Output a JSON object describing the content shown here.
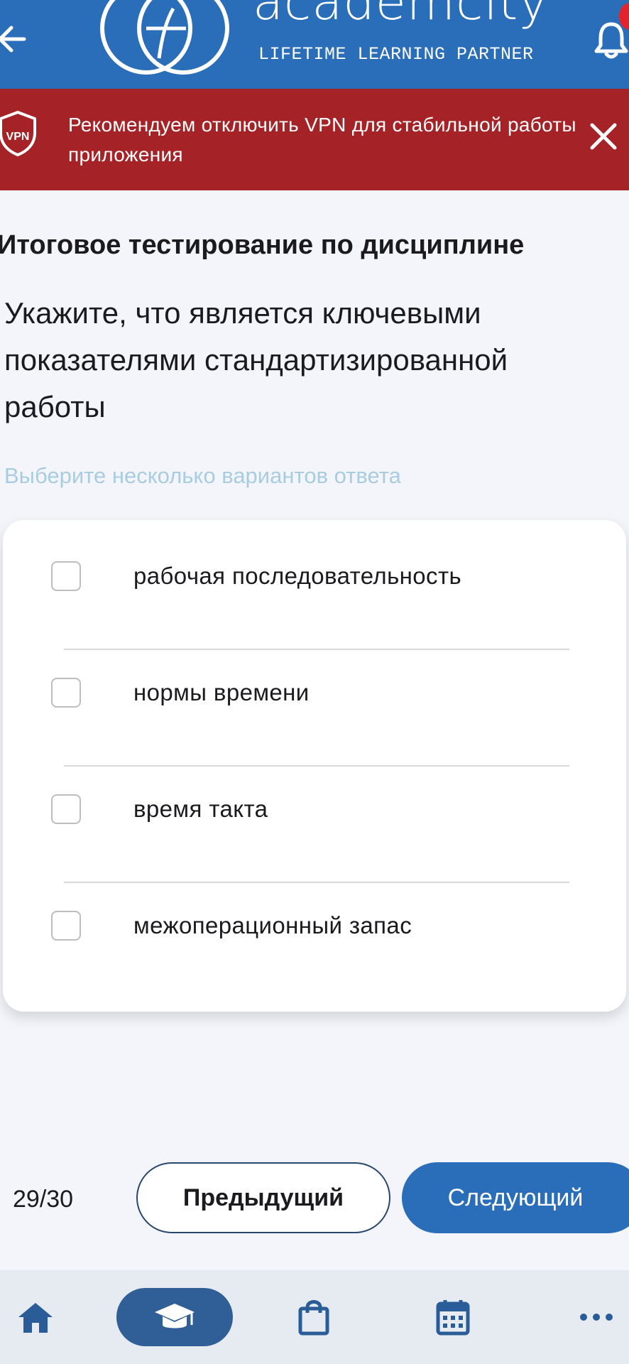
{
  "header": {
    "logo_word": "academcity",
    "logo_tagline": "LIFETIME LEARNING PARTNER",
    "back_icon": "arrow-left-icon",
    "bell_icon": "bell-icon"
  },
  "vpn_banner": {
    "badge": "VPN",
    "message": "Рекомендуем отключить VPN для стабильной работы приложения",
    "close_icon": "close-icon"
  },
  "test": {
    "title": "Итоговое тестирование по дисциплине",
    "question": "Укажите, что является ключевыми показателями стандартизированной работы",
    "hint": "Выберите несколько вариантов ответа",
    "options": [
      {
        "label": "рабочая последовательность",
        "checked": false
      },
      {
        "label": "нормы времени",
        "checked": false
      },
      {
        "label": "время такта",
        "checked": false
      },
      {
        "label": "межоперационный запас",
        "checked": false
      }
    ]
  },
  "pager": {
    "counter": "29/30",
    "prev_label": "Предыдущий",
    "next_label": "Следующий"
  },
  "bottom_nav": {
    "items": [
      "home-icon",
      "graduation-cap-icon",
      "shopping-bag-icon",
      "calendar-icon",
      "more-icon"
    ],
    "active": "graduation-cap-icon"
  },
  "colors": {
    "brand_blue": "#2a6db8",
    "banner_red": "#a52226",
    "hint_blue": "#a9cde0",
    "nav_active": "#2f5f96",
    "nav_icon": "#2a5d98"
  }
}
